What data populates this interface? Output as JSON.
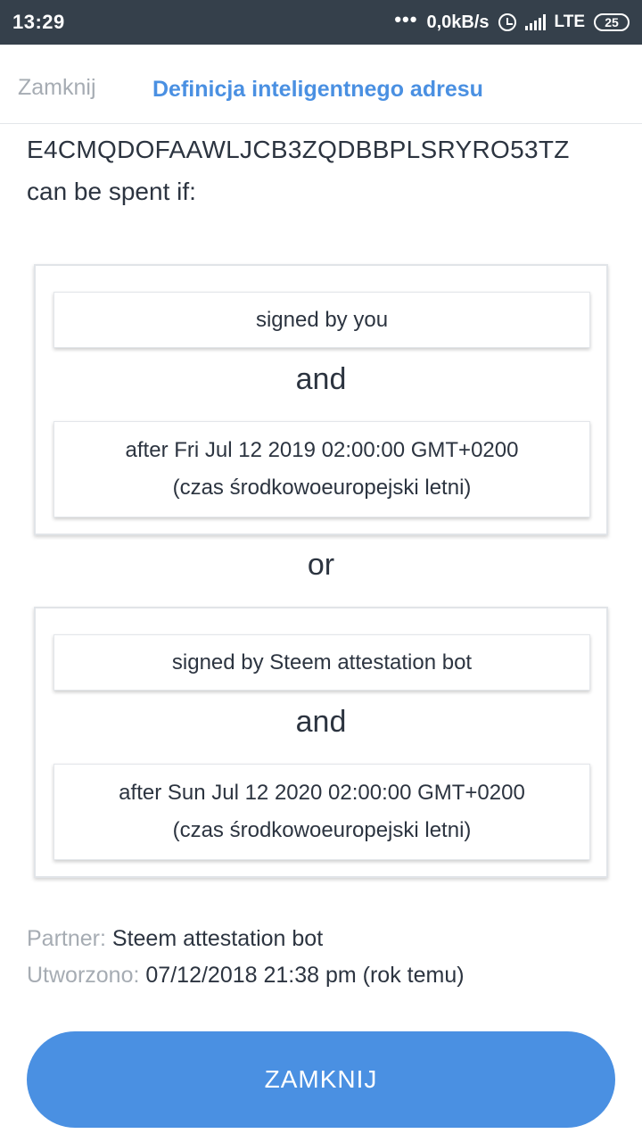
{
  "status_bar": {
    "time": "13:29",
    "dots": "•••",
    "speed": "0,0kB/s",
    "network": "LTE",
    "battery": "25"
  },
  "header": {
    "close_label": "Zamknij",
    "title": "Definicja inteligentnego adresu"
  },
  "address": "E4CMQDOFAAWLJCB3ZQDBBPLSRYRO53TZ",
  "intro": "can be spent if:",
  "groups": [
    {
      "first": "signed by you",
      "connector": "and",
      "second_line1": "after Fri Jul 12 2019 02:00:00 GMT+0200",
      "second_line2": "(czas środkowoeuropejski letni)"
    },
    {
      "first": "signed by Steem attestation bot",
      "connector": "and",
      "second_line1": "after Sun Jul 12 2020 02:00:00 GMT+0200",
      "second_line2": "(czas środkowoeuropejski letni)"
    }
  ],
  "between_groups": "or",
  "meta": {
    "partner_label": "Partner:",
    "partner_value": "Steem attestation bot",
    "created_label": "Utworzono:",
    "created_value": "07/12/2018 21:38 pm (rok temu)"
  },
  "close_button": "ZAMKNIJ",
  "colors": {
    "accent": "#4a90e2",
    "status_bar": "#35404b",
    "muted": "#a6acb3",
    "text": "#2c3440"
  }
}
